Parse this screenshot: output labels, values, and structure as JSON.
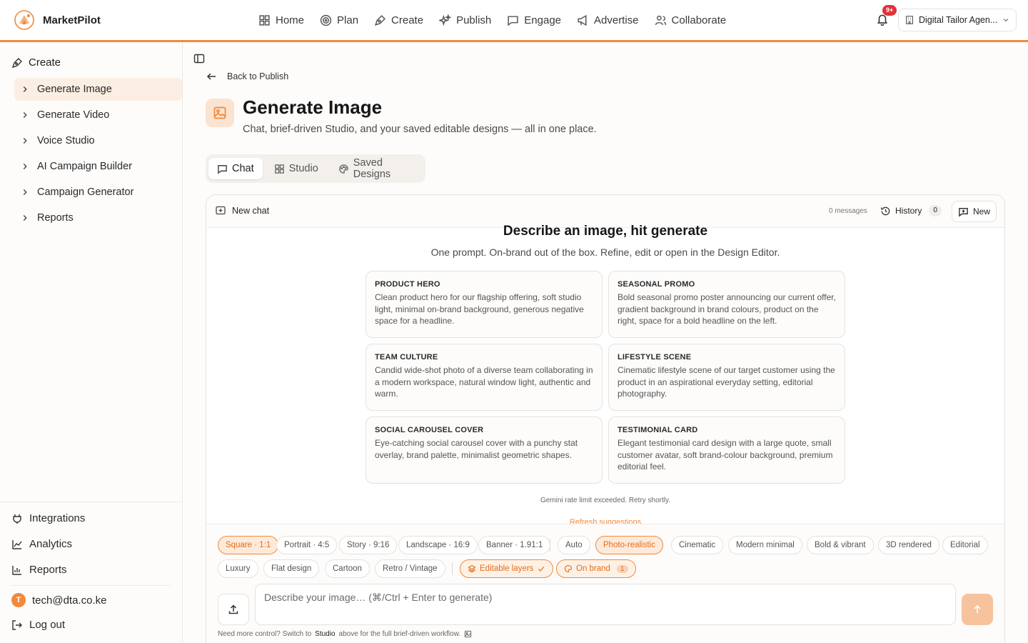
{
  "header": {
    "brand": "MarketPilot",
    "nav": [
      "Home",
      "Plan",
      "Create",
      "Publish",
      "Engage",
      "Advertise",
      "Collaborate"
    ],
    "notifications_badge": "9+",
    "org_name": "Digital Tailor Agen..."
  },
  "sidebar": {
    "section_title": "Create",
    "items": [
      {
        "label": "Generate Image"
      },
      {
        "label": "Generate Video"
      },
      {
        "label": "Voice Studio"
      },
      {
        "label": "AI Campaign Builder"
      },
      {
        "label": "Campaign Generator"
      },
      {
        "label": "Reports"
      }
    ],
    "bottom": {
      "integrations": "Integrations",
      "analytics": "Analytics",
      "reports": "Reports",
      "user_initial": "T",
      "user_email": "tech@dta.co.ke",
      "logout": "Log out"
    }
  },
  "main": {
    "back_label": "Back to Publish",
    "title": "Generate Image",
    "subtitle": "Chat, brief-driven Studio, and your saved editable designs — all in one place.",
    "tabs": [
      {
        "label": "Chat"
      },
      {
        "label": "Studio"
      },
      {
        "label": "Saved Designs"
      }
    ],
    "chat": {
      "new_chat_label": "New chat",
      "messages_count": "0 messages",
      "history_label": "History",
      "history_count": "0",
      "new_button": "New",
      "hero_title": "Describe an image, hit generate",
      "hero_subtitle": "One prompt. On-brand out of the box. Refine, edit or open in the Design Editor.",
      "suggestions": [
        {
          "title": "PRODUCT HERO",
          "body": "Clean product hero for our flagship offering, soft studio light, minimal on-brand background, generous negative space for a headline."
        },
        {
          "title": "SEASONAL PROMO",
          "body": "Bold seasonal promo poster announcing our current offer, gradient background in brand colours, product on the right, space for a bold headline on the left."
        },
        {
          "title": "TEAM CULTURE",
          "body": "Candid wide-shot photo of a diverse team collaborating in a modern workspace, natural window light, authentic and warm."
        },
        {
          "title": "LIFESTYLE SCENE",
          "body": "Cinematic lifestyle scene of our target customer using the product in an aspirational everyday setting, editorial photography."
        },
        {
          "title": "SOCIAL CAROUSEL COVER",
          "body": "Eye-catching social carousel cover with a punchy stat overlay, brand palette, minimalist geometric shapes."
        },
        {
          "title": "TESTIMONIAL CARD",
          "body": "Elegant testimonial card design with a large quote, small customer avatar, soft brand-colour background, premium editorial feel."
        }
      ],
      "rate_limit": "Gemini rate limit exceeded. Retry shortly.",
      "refresh_label": "Refresh suggestions",
      "aspect_chips": [
        "Square · 1:1",
        "Portrait · 4:5",
        "Story · 9:16",
        "Landscape · 16:9",
        "Banner · 1.91:1"
      ],
      "style_chips": [
        "Auto",
        "Photo-realistic",
        "Cinematic",
        "Modern minimal",
        "Bold & vibrant",
        "3D rendered",
        "Editorial",
        "Luxury",
        "Flat design",
        "Cartoon",
        "Retro / Vintage"
      ],
      "editable_layers": "Editable layers",
      "on_brand": "On brand",
      "on_brand_count": "1",
      "prompt_placeholder": "Describe your image… (⌘/Ctrl + Enter to generate)",
      "footer_prefix": "Need more control? Switch to",
      "footer_link": "Studio",
      "footer_suffix": "above for the full brief-driven workflow."
    }
  },
  "colors": {
    "accent": "#f08a3c",
    "accent_soft": "#fdeadb",
    "badge": "#e0313a"
  }
}
